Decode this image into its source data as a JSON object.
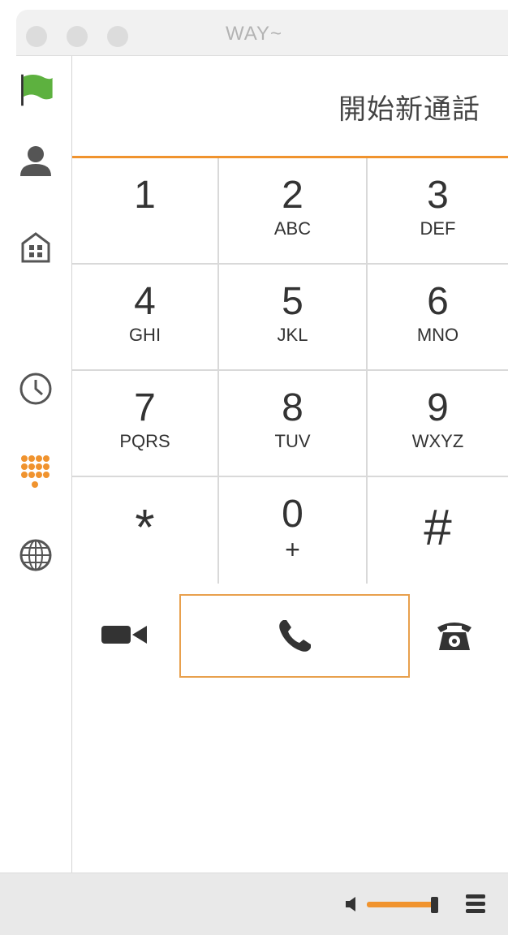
{
  "window": {
    "title": "WAY~"
  },
  "sidebar": {
    "items": [
      {
        "id": "status",
        "icon": "green-flag-icon"
      },
      {
        "id": "contacts",
        "icon": "person-icon"
      },
      {
        "id": "directory",
        "icon": "building-icon"
      },
      {
        "id": "history",
        "icon": "clock-icon"
      },
      {
        "id": "dialpad",
        "icon": "dialpad-icon",
        "active": true
      },
      {
        "id": "web",
        "icon": "globe-icon"
      }
    ]
  },
  "header": {
    "title": "開始新通話"
  },
  "keypad": {
    "keys": [
      {
        "digit": "1",
        "letters": ""
      },
      {
        "digit": "2",
        "letters": "ABC"
      },
      {
        "digit": "3",
        "letters": "DEF"
      },
      {
        "digit": "4",
        "letters": "GHI"
      },
      {
        "digit": "5",
        "letters": "JKL"
      },
      {
        "digit": "6",
        "letters": "MNO"
      },
      {
        "digit": "7",
        "letters": "PQRS"
      },
      {
        "digit": "8",
        "letters": "TUV"
      },
      {
        "digit": "9",
        "letters": "WXYZ"
      },
      {
        "digit": "*",
        "letters": ""
      },
      {
        "digit": "0",
        "letters": "+"
      },
      {
        "digit": "#",
        "letters": ""
      }
    ]
  },
  "actions": {
    "video_icon": "video-camera-icon",
    "call_icon": "phone-handset-icon",
    "deskphone_icon": "desk-phone-icon"
  },
  "footer": {
    "volume_level": 0.9,
    "menu_icon": "hamburger-menu-icon"
  },
  "colors": {
    "accent": "#f0932e",
    "flag": "#5db13f",
    "icon_gray": "#555555"
  }
}
